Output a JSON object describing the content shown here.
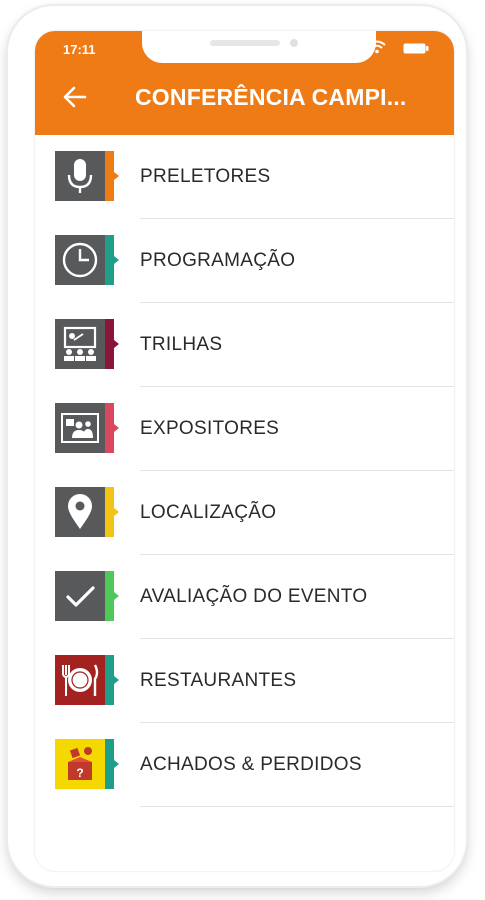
{
  "status_bar": {
    "time": "17:11"
  },
  "app_bar": {
    "title": "CONFERÊNCIA CAMPI...",
    "back_icon": "arrow-left-icon"
  },
  "colors": {
    "primary": "#ee7b16"
  },
  "menu": [
    {
      "label": "PRELETORES",
      "icon": "microphone-icon",
      "accent": "#ee7b16",
      "tile": "#58595b"
    },
    {
      "label": "PROGRAMAÇÃO",
      "icon": "clock-icon",
      "accent": "#1f9e8a",
      "tile": "#58595b"
    },
    {
      "label": "TRILHAS",
      "icon": "presentation-icon",
      "accent": "#8a1538",
      "tile": "#58595b"
    },
    {
      "label": "EXPOSITORES",
      "icon": "exhibitor-icon",
      "accent": "#d9485f",
      "tile": "#58595b"
    },
    {
      "label": "LOCALIZAÇÃO",
      "icon": "map-pin-icon",
      "accent": "#f2c417",
      "tile": "#58595b"
    },
    {
      "label": "AVALIAÇÃO DO EVENTO",
      "icon": "checkmark-icon",
      "accent": "#4fc85a",
      "tile": "#58595b"
    },
    {
      "label": "RESTAURANTES",
      "icon": "restaurant-icon",
      "accent": "#1f9e8a",
      "tile": "#a3211f"
    },
    {
      "label": "ACHADOS & PERDIDOS",
      "icon": "lost-and-found-icon",
      "accent": "#1f9e8a",
      "tile": "#f5d800"
    }
  ]
}
